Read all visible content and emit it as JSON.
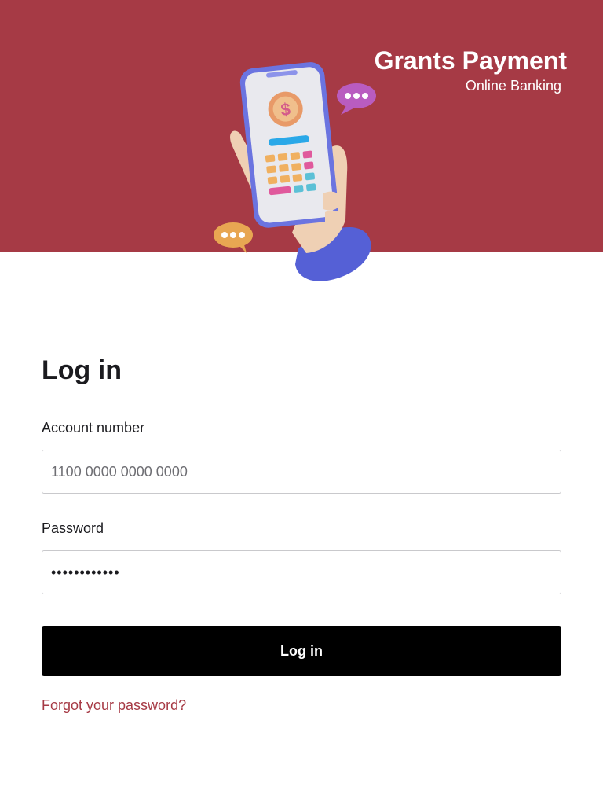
{
  "brand": {
    "title": "Grants Payment",
    "subtitle": "Online Banking"
  },
  "hero": {
    "background_color": "#a63a45",
    "illustration": "hand-holding-phone-payment-icon"
  },
  "login": {
    "title": "Log in",
    "account_label": "Account number",
    "account_placeholder": "1100 0000 0000 0000",
    "password_label": "Password",
    "password_value": "••••••••••••",
    "submit_label": "Log in",
    "forgot_label": "Forgot your password?"
  },
  "colors": {
    "accent": "#a63a45",
    "button": "#000000",
    "field_border": "#c9c9cc"
  }
}
